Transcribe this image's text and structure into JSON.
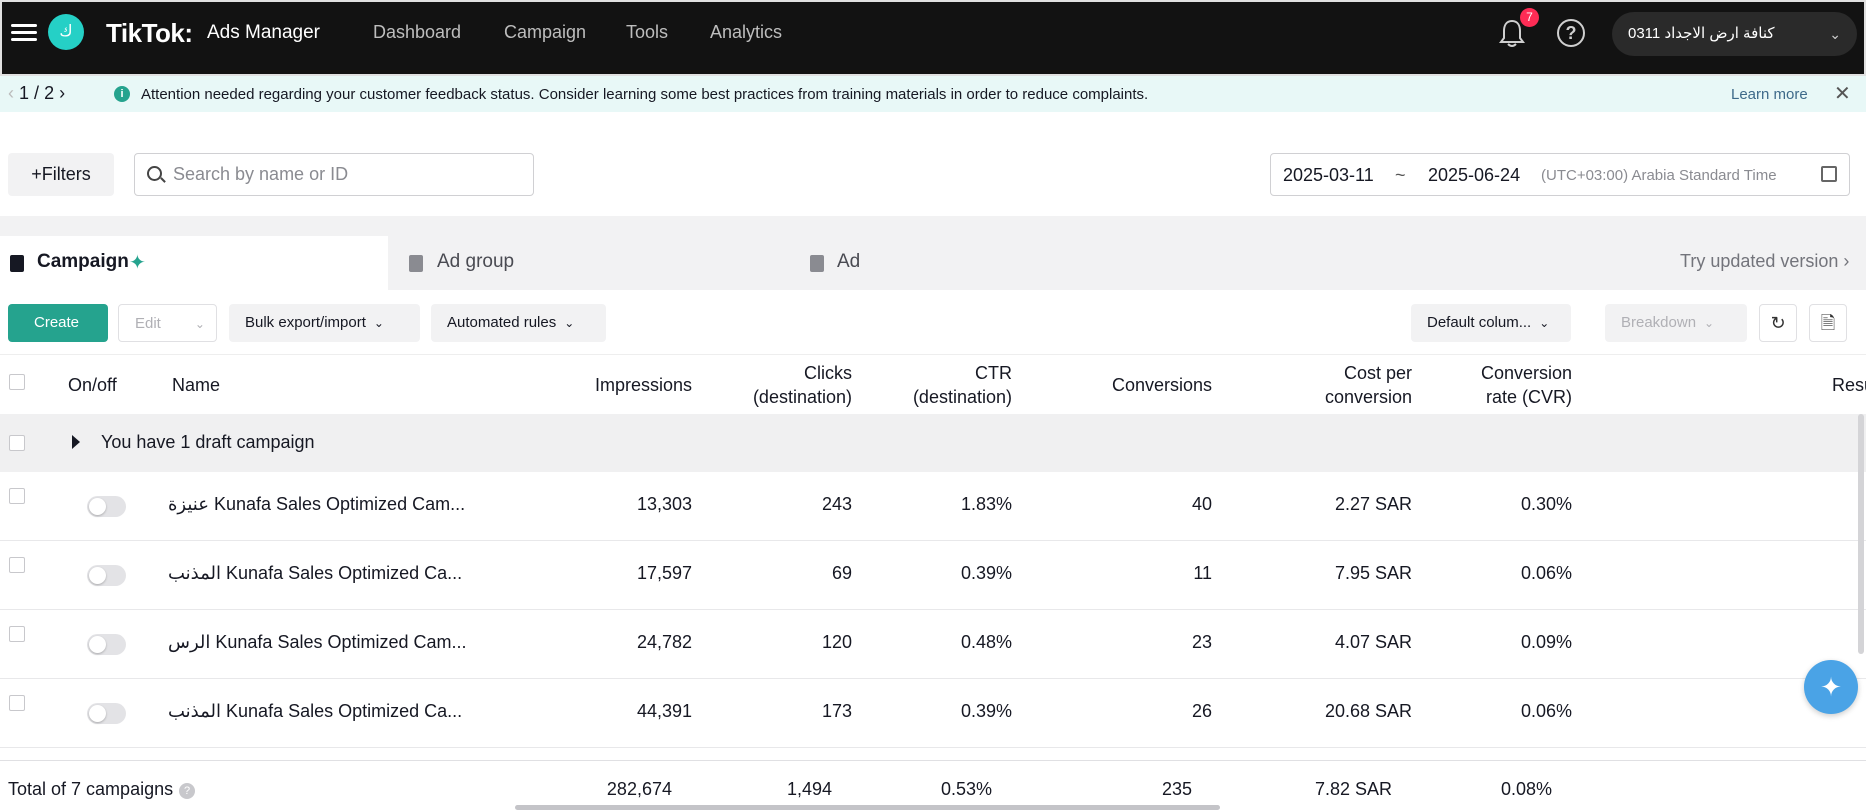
{
  "header": {
    "avatar_letter": "ك",
    "brand": "TikTok:",
    "product": "Ads Manager",
    "nav": [
      "Dashboard",
      "Campaign",
      "Tools",
      "Analytics"
    ],
    "notification_count": "7",
    "help_symbol": "?",
    "account_name": "0311 كنافة ارض الاجداد"
  },
  "notice": {
    "page_current": "1",
    "page_separator": "/",
    "page_total": "2",
    "message": "Attention needed regarding your customer feedback status. Consider learning some best practices from training materials in order to reduce complaints.",
    "learn_more": "Learn more"
  },
  "filter_bar": {
    "filters_label": "+Filters",
    "search_placeholder": "Search by name or ID",
    "date_start": "2025-03-11",
    "date_sep": "~",
    "date_end": "2025-06-24",
    "timezone": "(UTC+03:00) Arabia Standard Time"
  },
  "tabs": {
    "campaign": "Campaign",
    "ad_group": "Ad group",
    "ad": "Ad",
    "try_updated": "Try updated version"
  },
  "toolbar": {
    "create": "Create",
    "edit": "Edit",
    "bulk": "Bulk export/import",
    "rules": "Automated rules",
    "columns": "Default colum...",
    "breakdown": "Breakdown"
  },
  "table": {
    "headers": {
      "onoff": "On/off",
      "name": "Name",
      "impressions": "Impressions",
      "clicks_l1": "Clicks",
      "clicks_l2": "(destination)",
      "ctr_l1": "CTR",
      "ctr_l2": "(destination)",
      "conversions": "Conversions",
      "cpc_l1": "Cost per",
      "cpc_l2": "conversion",
      "cvr_l1": "Conversion",
      "cvr_l2": "rate (CVR)",
      "results": "Resu"
    },
    "draft_text": "You have 1 draft campaign",
    "rows": [
      {
        "name": "عنيزة Kunafa Sales Optimized Cam...",
        "impressions": "13,303",
        "clicks": "243",
        "ctr": "1.83%",
        "conversions": "40",
        "cost": "2.27 SAR",
        "cvr": "0.30%"
      },
      {
        "name": "المذنب Kunafa Sales Optimized Ca...",
        "impressions": "17,597",
        "clicks": "69",
        "ctr": "0.39%",
        "conversions": "11",
        "cost": "7.95 SAR",
        "cvr": "0.06%"
      },
      {
        "name": "الرس Kunafa Sales Optimized Cam...",
        "impressions": "24,782",
        "clicks": "120",
        "ctr": "0.48%",
        "conversions": "23",
        "cost": "4.07 SAR",
        "cvr": "0.09%"
      },
      {
        "name": "المذنب Kunafa Sales Optimized Ca...",
        "impressions": "44,391",
        "clicks": "173",
        "ctr": "0.39%",
        "conversions": "26",
        "cost": "20.68 SAR",
        "cvr": "0.06%"
      }
    ],
    "totals": {
      "label": "Total of 7 campaigns",
      "impressions": "282,674",
      "clicks": "1,494",
      "ctr": "0.53%",
      "conversions": "235",
      "cost": "7.82 SAR",
      "cvr": "0.08%"
    }
  },
  "colors": {
    "accent": "#25a38e",
    "topbar": "#121212",
    "notice_bg": "#e8f8f7",
    "badge": "#fe2c55"
  }
}
